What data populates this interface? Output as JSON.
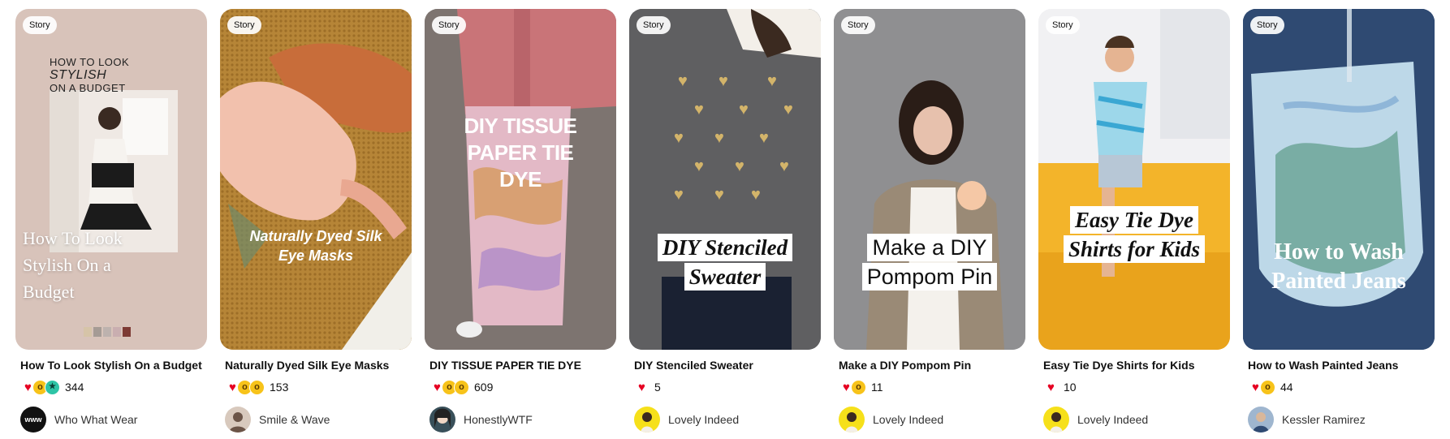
{
  "story_badge": "Story",
  "pins": [
    {
      "overlay_lines": [
        "HOW TO LOOK",
        "STYLISH",
        "ON A BUDGET"
      ],
      "overlay_big": "How To Look Stylish On a Budget",
      "title": "How To Look Stylish On a Budget",
      "reactions": [
        "heart-reaction",
        "wow-reaction",
        "good-idea-reaction"
      ],
      "count": "344",
      "creator": "Who What Wear",
      "avatar_text": "www",
      "colors": {
        "bg": "#d7c1b8"
      }
    },
    {
      "overlay_text": "Naturally Dyed Silk Eye Masks",
      "title": "Naturally Dyed Silk Eye Masks",
      "reactions": [
        "heart-reaction",
        "wow-reaction",
        "wow-reaction"
      ],
      "count": "153",
      "creator": "Smile & Wave",
      "colors": {
        "bg": "#b9873c"
      }
    },
    {
      "overlay_text": "DIY TISSUE PAPER TIE DYE",
      "title": "DIY TISSUE PAPER TIE DYE",
      "reactions": [
        "heart-reaction",
        "wow-reaction",
        "wow-reaction"
      ],
      "count": "609",
      "creator": "HonestlyWTF",
      "colors": {
        "bg": "#7a716c"
      }
    },
    {
      "overlay_text": "DIY Stenciled Sweater",
      "title": "DIY Stenciled Sweater",
      "reactions": [
        "heart-reaction"
      ],
      "count": "5",
      "creator": "Lovely Indeed",
      "colors": {
        "bg": "#5a5a5c"
      }
    },
    {
      "overlay_text": "Make a DIY Pompom Pin",
      "title": "Make a DIY Pompom Pin",
      "reactions": [
        "heart-reaction",
        "wow-reaction"
      ],
      "count": "11",
      "creator": "Lovely Indeed",
      "colors": {
        "bg": "#8c8c8e"
      }
    },
    {
      "overlay_text": "Easy Tie Dye Shirts for Kids",
      "title": "Easy Tie Dye Shirts for Kids",
      "reactions": [
        "heart-reaction"
      ],
      "count": "10",
      "creator": "Lovely Indeed",
      "colors": {
        "bg": "#f2b21f"
      }
    },
    {
      "overlay_text": "How to Wash Painted Jeans",
      "title": "How to Wash Painted Jeans",
      "reactions": [
        "heart-reaction",
        "wow-reaction"
      ],
      "count": "44",
      "creator": "Kessler Ramirez",
      "colors": {
        "bg": "#34507a"
      }
    }
  ]
}
